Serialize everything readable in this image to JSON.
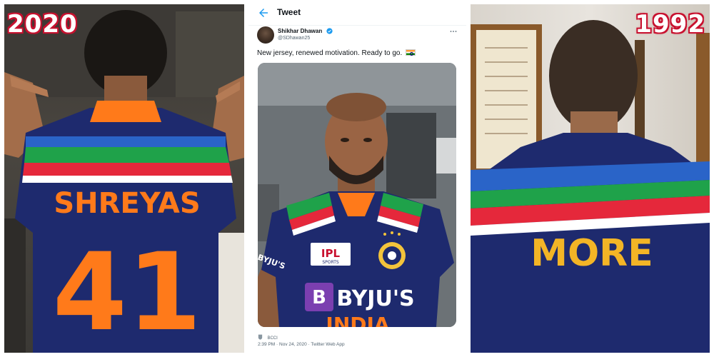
{
  "labels": {
    "left_year": "2020",
    "right_year": "1992"
  },
  "left_jersey": {
    "name": "SHREYAS",
    "number": "41"
  },
  "right_jersey": {
    "name": "MORE"
  },
  "tweet": {
    "header_title": "Tweet",
    "author_name": "Shikhar Dhawan",
    "author_handle": "@SDhawan25",
    "text": "New jersey, renewed motivation. Ready to go.",
    "text_emoji": "india-flag",
    "media_texts": {
      "ipl_logo": "IPL",
      "ipl_sub": "SPORTS",
      "sponsor": "BYJU'S",
      "sponsor_icon": "B",
      "sleeve_text": "BYJU'S",
      "bottom_text": "INDIA"
    },
    "source_label": "BCCI",
    "time": "2:39 PM",
    "date": "Nov 24, 2020",
    "client": "Twitter Web App"
  },
  "colors": {
    "accent_red": "#c8102e",
    "twitter_blue": "#1d9bf0",
    "jersey_navy": "#1e2a6e",
    "jersey_orange": "#ff7a1a",
    "stripe_green": "#1fa24a",
    "stripe_red": "#e5283b",
    "sponsor_purple": "#7b3fb0"
  },
  "icons": [
    "back-arrow-icon",
    "verified-badge-icon",
    "more-dots-icon",
    "india-flag-icon",
    "bcci-logo-icon"
  ]
}
